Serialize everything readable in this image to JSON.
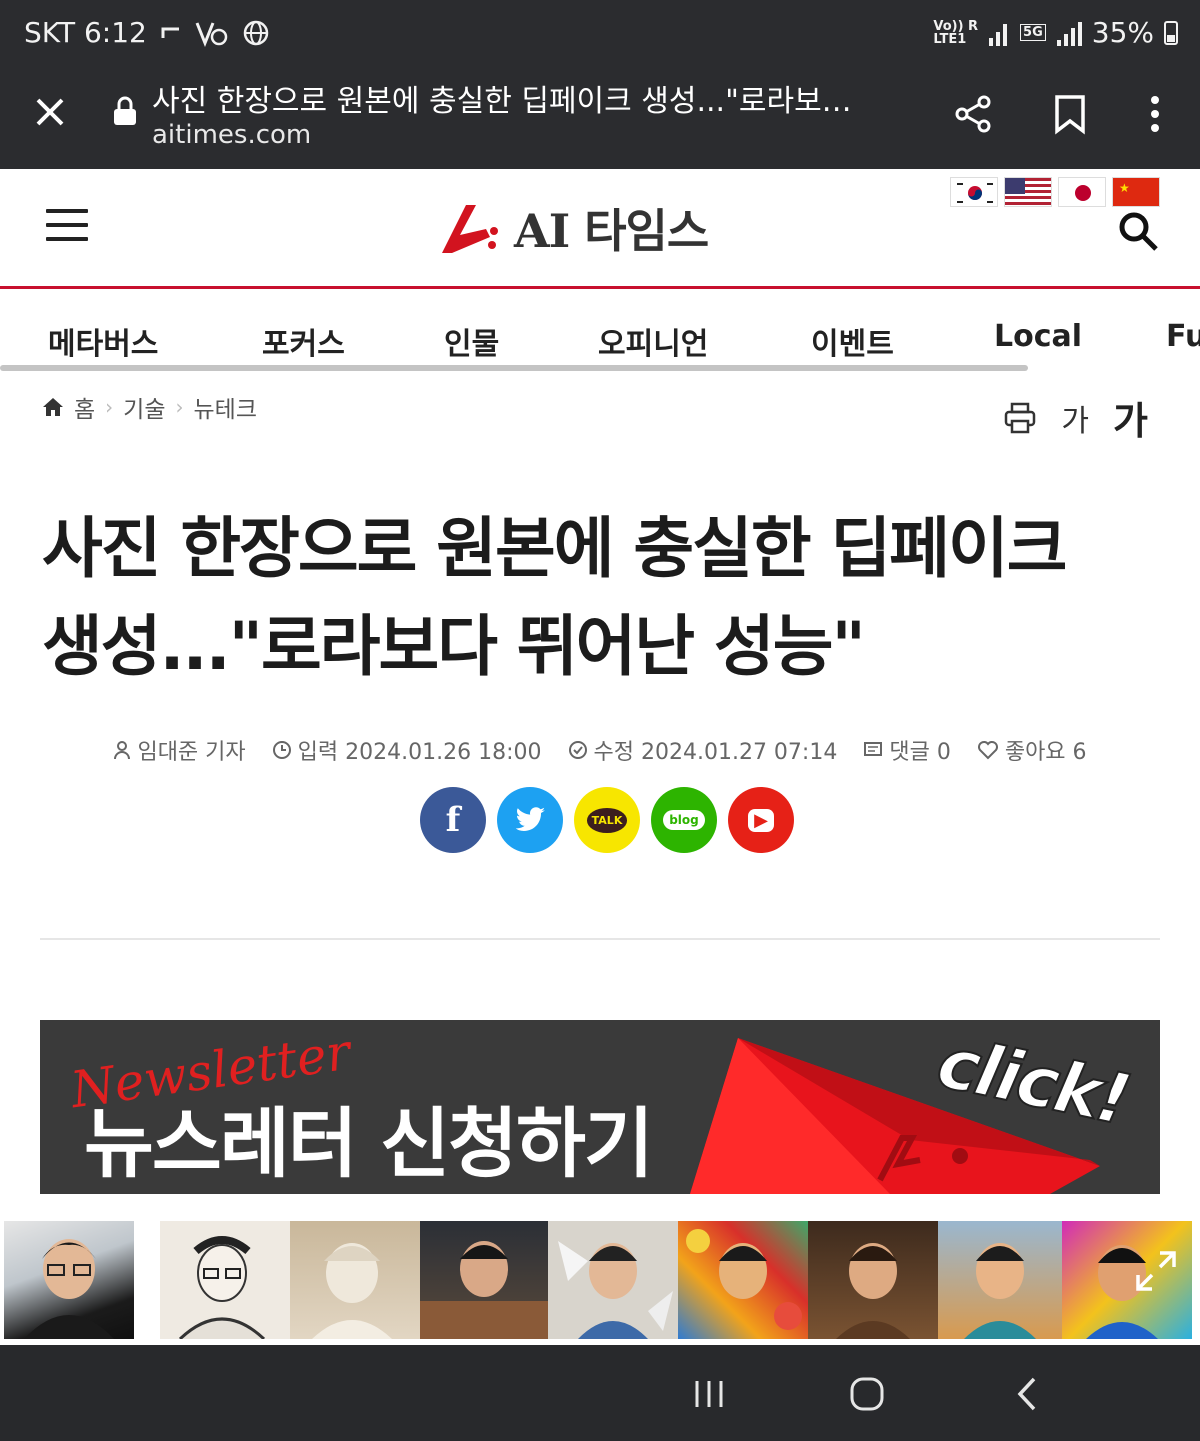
{
  "status_bar": {
    "carrier_time": "SKT 6:12",
    "volte": "Vo)) R",
    "lte": "LTE1",
    "net": "5G",
    "battery": "35%"
  },
  "browser": {
    "page_title": "사진 한장으로 원본에 충실한 딥페이크 생성...\"로라보…",
    "url": "aitimes.com",
    "icons": [
      "close-icon",
      "lock-icon",
      "share-icon",
      "bookmark-icon",
      "more-icon"
    ]
  },
  "site": {
    "logo_text": "AI 타임스",
    "brand_color": "#c8102e",
    "flags": [
      "korea-flag",
      "usa-flag",
      "japan-flag",
      "china-flag"
    ]
  },
  "nav": {
    "items": [
      "메타버스",
      "포커스",
      "인물",
      "오피니언",
      "이벤트",
      "Local",
      "Fu"
    ]
  },
  "breadcrumb": [
    "홈",
    "기술",
    "뉴테크"
  ],
  "tools": {
    "font_small": "가",
    "font_large": "가"
  },
  "article": {
    "headline_line1": "사진 한장으로 원본에 충실한 딥페이크",
    "headline_line2": "생성...\"로라보다 뛰어난 성능\"",
    "author": "임대준 기자",
    "published": "입력 2024.01.26 18:00",
    "modified": "수정 2024.01.27 07:14",
    "comments": "댓글 0",
    "likes": "좋아요 6"
  },
  "share": [
    {
      "label": "f",
      "color": "#3b5998"
    },
    {
      "label": "t",
      "color": "#1da1f2"
    },
    {
      "label": "TALK",
      "color": "#f7e600"
    },
    {
      "label": "blog",
      "color": "#2db400"
    },
    {
      "label": "▶",
      "color": "#e62117"
    }
  ],
  "banner": {
    "script": "Newsletter",
    "title": "뉴스레터 신청하기",
    "click": "click!"
  }
}
